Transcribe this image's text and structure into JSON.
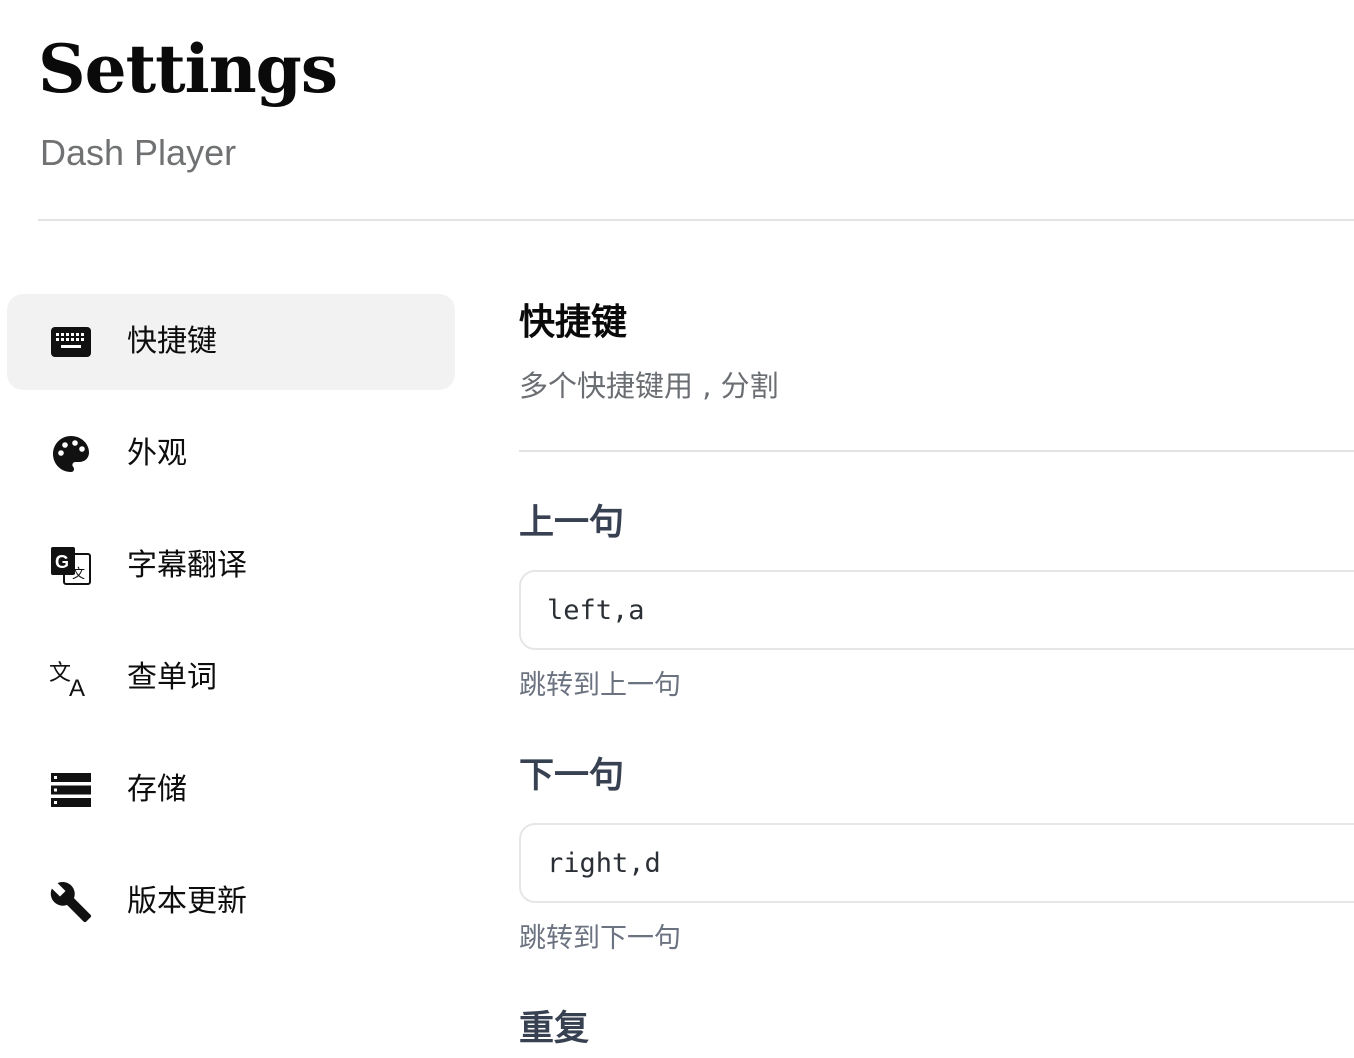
{
  "header": {
    "title": "Settings",
    "subtitle": "Dash Player"
  },
  "sidebar": {
    "items": [
      {
        "label": "快捷键",
        "icon": "keyboard-icon",
        "active": true
      },
      {
        "label": "外观",
        "icon": "palette-icon",
        "active": false
      },
      {
        "label": "字幕翻译",
        "icon": "google-translate-icon",
        "active": false
      },
      {
        "label": "查单词",
        "icon": "translate-icon",
        "active": false
      },
      {
        "label": "存储",
        "icon": "storage-icon",
        "active": false
      },
      {
        "label": "版本更新",
        "icon": "wrench-icon",
        "active": false
      }
    ]
  },
  "main": {
    "title": "快捷键",
    "description": "多个快捷键用 , 分割",
    "fields": [
      {
        "label": "上一句",
        "value": "left,a",
        "hint": "跳转到上一句"
      },
      {
        "label": "下一句",
        "value": "right,d",
        "hint": "跳转到下一句"
      },
      {
        "label": "重复",
        "value": "",
        "hint": ""
      }
    ]
  },
  "colors": {
    "active_item_bg": "#f2f2f3",
    "divider": "#e2e3e5",
    "subtitle": "#6f7173",
    "hint": "#6b7280"
  }
}
